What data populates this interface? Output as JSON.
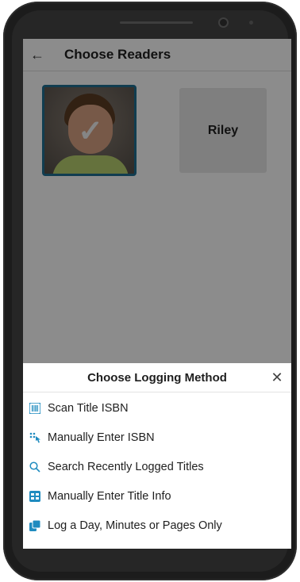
{
  "header": {
    "back_icon": "arrow-left-icon",
    "title": "Choose Readers"
  },
  "readers": [
    {
      "name": "",
      "selected": true,
      "has_photo": true
    },
    {
      "name": "Riley",
      "selected": false,
      "has_photo": false
    }
  ],
  "sheet": {
    "title": "Choose Logging Method",
    "close_icon": "close-icon",
    "options": [
      {
        "label": "Scan Title ISBN",
        "icon": "barcode-icon"
      },
      {
        "label": "Manually Enter ISBN",
        "icon": "keypad-tap-icon"
      },
      {
        "label": "Search Recently Logged Titles",
        "icon": "search-icon"
      },
      {
        "label": "Manually Enter Title Info",
        "icon": "table-icon"
      },
      {
        "label": "Log a Day, Minutes or Pages Only",
        "icon": "copy-icon"
      }
    ]
  },
  "colors": {
    "accent": "#1f8bbf",
    "selected_border": "#1f6f92"
  }
}
